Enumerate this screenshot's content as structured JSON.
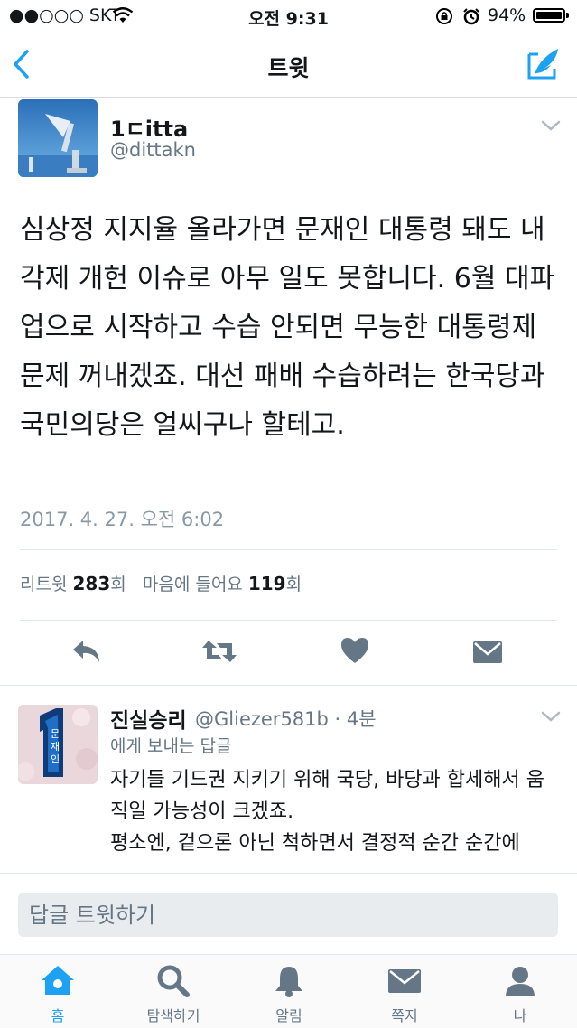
{
  "status_bar": {
    "carrier": "●●○○○ SKT",
    "time": "오전 9:31",
    "battery": "94%"
  },
  "nav": {
    "title": "트윗"
  },
  "tweet": {
    "display_name": "1ㄷitta",
    "handle": "@dittakn",
    "text": "심상정 지지율 올라가면 문재인 대통령 돼도 내각제 개헌 이슈로 아무 일도 못합니다. 6월 대파업으로 시작하고 수습 안되면 무능한 대통령제 문제 꺼내겠죠. 대선 패배 수습하려는  한국당과 국민의당은 얼씨구나 할테고.",
    "timestamp": "2017. 4. 27. 오전 6:02",
    "retweet_label": "리트윗",
    "retweet_count": "283",
    "count_unit_1": "회",
    "likes_label": "마음에 들어요",
    "likes_count": "119",
    "count_unit_2": "회"
  },
  "reply": {
    "display_name": "진실승리",
    "handle_time": "@Gliezer581b · 4분",
    "reply_to": "에게 보내는 답글",
    "text_line1": "자기들 기드권 지키기 위해 국당, 바당과 합세해서 움직일 가능성이 크겠죠.",
    "text_line2": "평소엔, 겉으론 아닌 척하면서 결정적 순간 순간에",
    "avatar_text": "문재인"
  },
  "reply_input": {
    "placeholder": "답글 트윗하기"
  },
  "tabs": [
    {
      "label": "홈"
    },
    {
      "label": "탐색하기"
    },
    {
      "label": "알림"
    },
    {
      "label": "쪽지"
    },
    {
      "label": "나"
    }
  ],
  "colors": {
    "accent": "#1da1f2",
    "icon_gray": "#657786",
    "text": "#14171a"
  }
}
